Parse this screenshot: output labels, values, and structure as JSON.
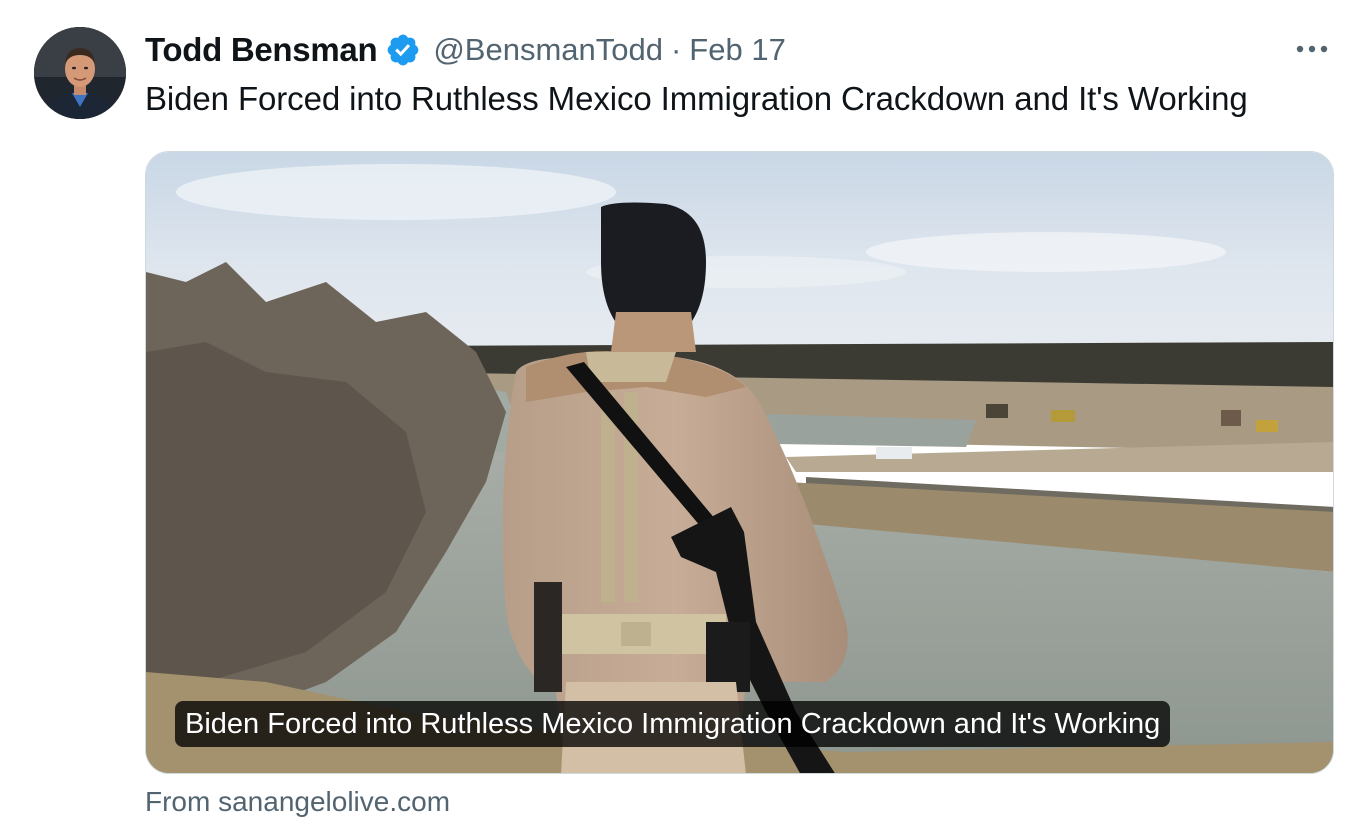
{
  "tweet": {
    "author": {
      "display_name": "Todd Bensman",
      "handle": "@BensmanTodd",
      "verified": true,
      "avatar_icon": "profile-photo"
    },
    "separator": "·",
    "date": "Feb 17",
    "more_icon": "more-horizontal-icon",
    "text": "Biden Forced into Ruthless Mexico Immigration Crackdown and It's Working",
    "card": {
      "image_description_icon": "link-card-photo",
      "caption": "Biden Forced into Ruthless Mexico Immigration Crackdown and It's Working",
      "source": "From sanangelolive.com"
    }
  },
  "colors": {
    "verified_badge": "#1d9bf0",
    "secondary_text": "#536471",
    "primary_text": "#0f1419",
    "border": "#cfd9de"
  }
}
